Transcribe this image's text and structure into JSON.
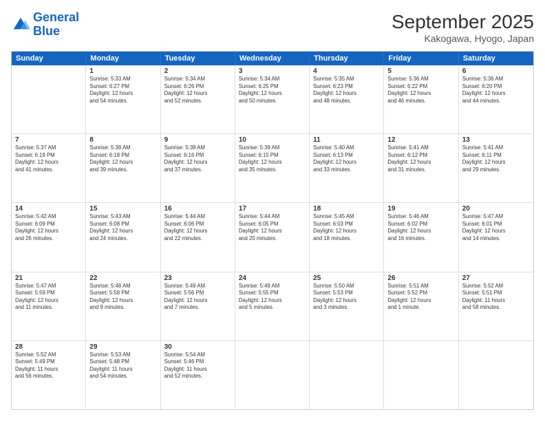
{
  "logo": {
    "line1": "General",
    "line2": "Blue"
  },
  "title": "September 2025",
  "location": "Kakogawa, Hyogo, Japan",
  "header_days": [
    "Sunday",
    "Monday",
    "Tuesday",
    "Wednesday",
    "Thursday",
    "Friday",
    "Saturday"
  ],
  "weeks": [
    [
      {
        "day": "",
        "info": ""
      },
      {
        "day": "1",
        "info": "Sunrise: 5:33 AM\nSunset: 6:27 PM\nDaylight: 12 hours\nand 54 minutes."
      },
      {
        "day": "2",
        "info": "Sunrise: 5:34 AM\nSunset: 6:26 PM\nDaylight: 12 hours\nand 52 minutes."
      },
      {
        "day": "3",
        "info": "Sunrise: 5:34 AM\nSunset: 6:25 PM\nDaylight: 12 hours\nand 50 minutes."
      },
      {
        "day": "4",
        "info": "Sunrise: 5:35 AM\nSunset: 6:23 PM\nDaylight: 12 hours\nand 48 minutes."
      },
      {
        "day": "5",
        "info": "Sunrise: 5:36 AM\nSunset: 6:22 PM\nDaylight: 12 hours\nand 46 minutes."
      },
      {
        "day": "6",
        "info": "Sunrise: 5:36 AM\nSunset: 6:20 PM\nDaylight: 12 hours\nand 44 minutes."
      }
    ],
    [
      {
        "day": "7",
        "info": "Sunrise: 5:37 AM\nSunset: 6:19 PM\nDaylight: 12 hours\nand 41 minutes."
      },
      {
        "day": "8",
        "info": "Sunrise: 5:38 AM\nSunset: 6:18 PM\nDaylight: 12 hours\nand 39 minutes."
      },
      {
        "day": "9",
        "info": "Sunrise: 5:39 AM\nSunset: 6:16 PM\nDaylight: 12 hours\nand 37 minutes."
      },
      {
        "day": "10",
        "info": "Sunrise: 5:39 AM\nSunset: 6:15 PM\nDaylight: 12 hours\nand 35 minutes."
      },
      {
        "day": "11",
        "info": "Sunrise: 5:40 AM\nSunset: 6:13 PM\nDaylight: 12 hours\nand 33 minutes."
      },
      {
        "day": "12",
        "info": "Sunrise: 5:41 AM\nSunset: 6:12 PM\nDaylight: 12 hours\nand 31 minutes."
      },
      {
        "day": "13",
        "info": "Sunrise: 5:41 AM\nSunset: 6:11 PM\nDaylight: 12 hours\nand 29 minutes."
      }
    ],
    [
      {
        "day": "14",
        "info": "Sunrise: 5:42 AM\nSunset: 6:09 PM\nDaylight: 12 hours\nand 26 minutes."
      },
      {
        "day": "15",
        "info": "Sunrise: 5:43 AM\nSunset: 6:08 PM\nDaylight: 12 hours\nand 24 minutes."
      },
      {
        "day": "16",
        "info": "Sunrise: 5:44 AM\nSunset: 6:06 PM\nDaylight: 12 hours\nand 22 minutes."
      },
      {
        "day": "17",
        "info": "Sunrise: 5:44 AM\nSunset: 6:05 PM\nDaylight: 12 hours\nand 20 minutes."
      },
      {
        "day": "18",
        "info": "Sunrise: 5:45 AM\nSunset: 6:03 PM\nDaylight: 12 hours\nand 18 minutes."
      },
      {
        "day": "19",
        "info": "Sunrise: 5:46 AM\nSunset: 6:02 PM\nDaylight: 12 hours\nand 16 minutes."
      },
      {
        "day": "20",
        "info": "Sunrise: 5:47 AM\nSunset: 6:01 PM\nDaylight: 12 hours\nand 14 minutes."
      }
    ],
    [
      {
        "day": "21",
        "info": "Sunrise: 5:47 AM\nSunset: 5:59 PM\nDaylight: 12 hours\nand 11 minutes."
      },
      {
        "day": "22",
        "info": "Sunrise: 5:48 AM\nSunset: 5:58 PM\nDaylight: 12 hours\nand 9 minutes."
      },
      {
        "day": "23",
        "info": "Sunrise: 5:49 AM\nSunset: 5:56 PM\nDaylight: 12 hours\nand 7 minutes."
      },
      {
        "day": "24",
        "info": "Sunrise: 5:49 AM\nSunset: 5:55 PM\nDaylight: 12 hours\nand 5 minutes."
      },
      {
        "day": "25",
        "info": "Sunrise: 5:50 AM\nSunset: 5:53 PM\nDaylight: 12 hours\nand 3 minutes."
      },
      {
        "day": "26",
        "info": "Sunrise: 5:51 AM\nSunset: 5:52 PM\nDaylight: 12 hours\nand 1 minute."
      },
      {
        "day": "27",
        "info": "Sunrise: 5:52 AM\nSunset: 5:51 PM\nDaylight: 11 hours\nand 58 minutes."
      }
    ],
    [
      {
        "day": "28",
        "info": "Sunrise: 5:52 AM\nSunset: 5:49 PM\nDaylight: 11 hours\nand 56 minutes."
      },
      {
        "day": "29",
        "info": "Sunrise: 5:53 AM\nSunset: 5:48 PM\nDaylight: 11 hours\nand 54 minutes."
      },
      {
        "day": "30",
        "info": "Sunrise: 5:54 AM\nSunset: 5:46 PM\nDaylight: 11 hours\nand 52 minutes."
      },
      {
        "day": "",
        "info": ""
      },
      {
        "day": "",
        "info": ""
      },
      {
        "day": "",
        "info": ""
      },
      {
        "day": "",
        "info": ""
      }
    ]
  ]
}
